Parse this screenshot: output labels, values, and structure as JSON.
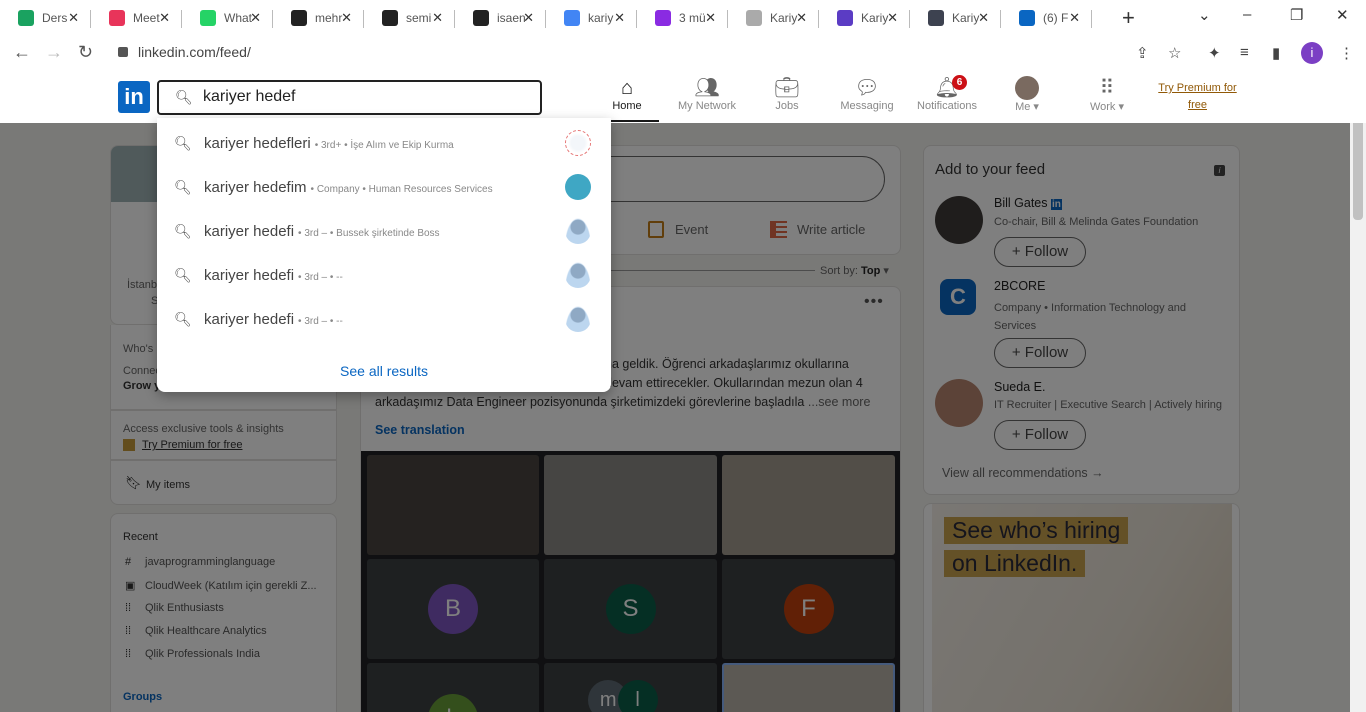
{
  "browser": {
    "tabs": [
      {
        "title": "Ders",
        "icon": "green-cross-icon",
        "color": "#1aa260"
      },
      {
        "title": "Meet",
        "icon": "play-icon",
        "color": "#e8345a"
      },
      {
        "title": "What",
        "icon": "whatsapp-icon",
        "color": "#25d366"
      },
      {
        "title": "mehr",
        "icon": "github-icon",
        "color": "#222222"
      },
      {
        "title": "semi",
        "icon": "github-icon",
        "color": "#222222"
      },
      {
        "title": "isaen",
        "icon": "github-icon",
        "color": "#222222"
      },
      {
        "title": "kariy",
        "icon": "google-icon",
        "color": "#4285f4"
      },
      {
        "title": "3 mü",
        "icon": "k-icon",
        "color": "#8a2be2"
      },
      {
        "title": "Kariy",
        "icon": "microphone-icon",
        "color": "#aaaaaa"
      },
      {
        "title": "Kariy",
        "icon": "smiley-icon",
        "color": "#5b3cc4"
      },
      {
        "title": "Kariy",
        "icon": "compass-icon",
        "color": "#3d4250"
      },
      {
        "title": "(6) F",
        "icon": "linkedin-icon",
        "color": "#0a66c2"
      }
    ],
    "url": "linkedin.com/feed/",
    "profile_initial": "i"
  },
  "nav": {
    "logo": "in",
    "search_value": "kariyer hedef",
    "items": [
      {
        "label": "Home",
        "icon": "home-icon"
      },
      {
        "label": "My Network",
        "icon": "network-icon"
      },
      {
        "label": "Jobs",
        "icon": "briefcase-icon"
      },
      {
        "label": "Messaging",
        "icon": "message-icon"
      },
      {
        "label": "Notifications",
        "icon": "bell-icon",
        "badge": "6"
      },
      {
        "label": "Me",
        "icon": "avatar"
      },
      {
        "label": "Work",
        "icon": "grid-icon"
      }
    ],
    "premium": "Try Premium for free"
  },
  "suggestions": [
    {
      "main": "kariyer hedefleri",
      "meta": "• 3rd+ • İşe Alım ve Ekip Kurma"
    },
    {
      "main": "kariyer hedefim",
      "meta": "• Company • Human Resources Services"
    },
    {
      "main": "kariyer hedefi",
      "meta": "• 3rd – • Bussek şirketinde Boss"
    },
    {
      "main": "kariyer hedefi",
      "meta": "• 3rd – • --"
    },
    {
      "main": "kariyer hedefi",
      "meta": "• 3rd – • --"
    }
  ],
  "see_all": "See all results",
  "left": {
    "location_partial": "İstanb",
    "location_partial2": "S",
    "whos_viewed": "Who's",
    "connect": "Connec",
    "grow": "Grow y",
    "access": "Access exclusive tools & insights",
    "try_premium": "Try Premium for free",
    "my_items": "My items",
    "recent_title": "Recent",
    "recent": [
      {
        "label": "javaprogramminglanguage",
        "icon": "hashtag-icon"
      },
      {
        "label": "CloudWeek (Katılım için gerekli Z...",
        "icon": "calendar-icon"
      },
      {
        "label": "Qlik Enthusiasts",
        "icon": "group-icon"
      },
      {
        "label": "Qlik Healthcare Analytics",
        "icon": "group-icon"
      },
      {
        "label": "Qlik Professionals India",
        "icon": "group-icon"
      }
    ],
    "groups": "Groups"
  },
  "center": {
    "event": "Event",
    "write_article": "Write article",
    "sort_label": "Sort by:",
    "sort_value": "Top",
    "post_lines": [
      "na geldik. Öğrenci arkadaşlarımız okullarına",
      "devam ettirecekler. Okullarından mezun olan 4",
      "arkadaşımız Data Engineer pozisyonunda şirketimizdeki görevlerine başladıla"
    ],
    "see_more": "...see more",
    "see_translation": "See translation",
    "tiles": [
      {
        "initial": "B",
        "color": "#7e57c2"
      },
      {
        "initial": "S",
        "color": "#0b5e49"
      },
      {
        "initial": "F",
        "color": "#c2410c"
      },
      {
        "initial": "h",
        "color": "#689f38"
      }
    ],
    "pair_initials": [
      "m",
      "l"
    ]
  },
  "right": {
    "title": "Add to your feed",
    "people": [
      {
        "name": "Bill Gates",
        "desc": "Co-chair, Bill & Melinda Gates Foundation"
      },
      {
        "name": "2BCORE",
        "desc": "Company • Information Technology and Services"
      },
      {
        "name": "Sueda E.",
        "desc": "IT Recruiter | Executive Search | Actively hiring"
      }
    ],
    "follow": "Follow",
    "view_all": "View all recommendations →",
    "ad_line1": "See who’s hiring",
    "ad_line2": "on LinkedIn."
  }
}
